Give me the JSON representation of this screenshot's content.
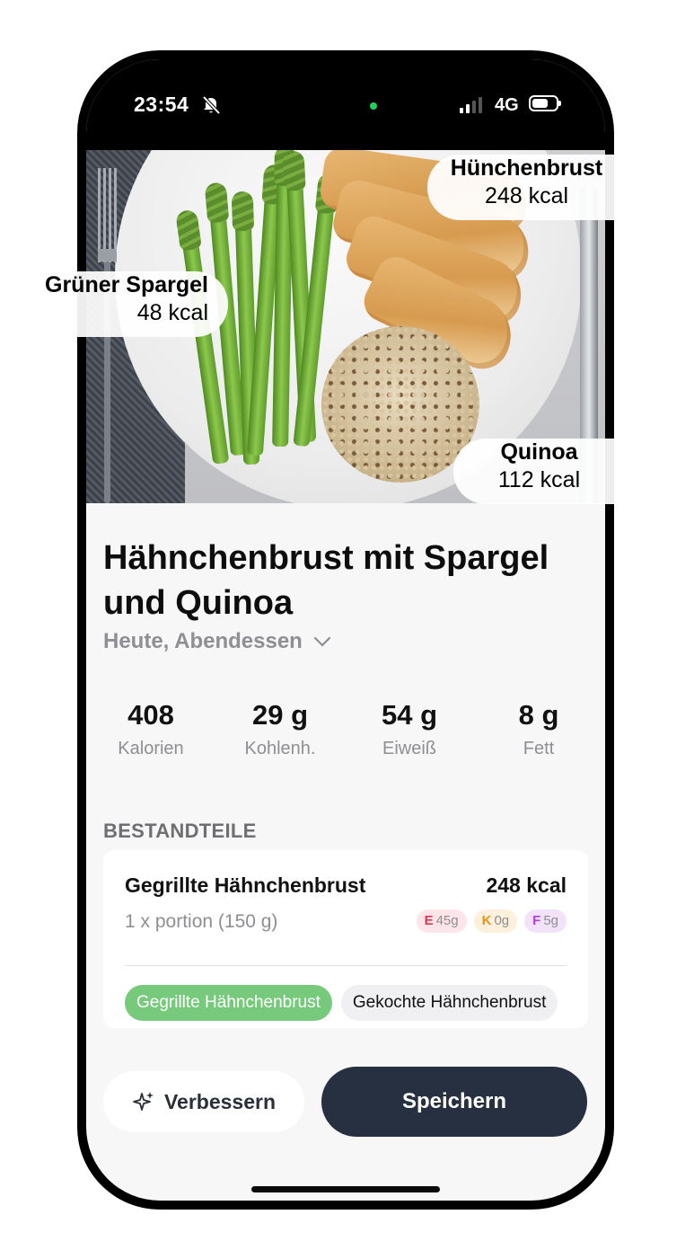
{
  "status": {
    "time": "23:54",
    "network": "4G"
  },
  "photo_labels": [
    {
      "name": "Hünchenbrust",
      "kcal": "248 kcal"
    },
    {
      "name": "Grüner Spargel",
      "kcal": "48 kcal"
    },
    {
      "name": "Quinoa",
      "kcal": "112 kcal"
    }
  ],
  "meal": {
    "title": "Hähnchenbrust mit Spargel und Quinoa",
    "subtitle": "Heute, Abendessen"
  },
  "stats": [
    {
      "value": "408",
      "label": "Kalorien"
    },
    {
      "value": "29 g",
      "label": "Kohlenh."
    },
    {
      "value": "54 g",
      "label": "Eiweiß"
    },
    {
      "value": "8 g",
      "label": "Fett"
    }
  ],
  "section_title": "BESTANDTEILE",
  "ingredient": {
    "name": "Gegrillte Hähnchenbrust",
    "kcal": "248 kcal",
    "portion": "1 x portion (150 g)",
    "macros": [
      {
        "key": "E",
        "value": "45g",
        "color": "#e23552"
      },
      {
        "key": "K",
        "value": "0g",
        "color": "#e8931c"
      },
      {
        "key": "F",
        "value": "5g",
        "color": "#b13ee0"
      }
    ],
    "alternatives": [
      "Gegrillte Hähnchenbrust",
      "Gekochte Hähnchenbrust"
    ]
  },
  "actions": {
    "improve": "Verbessern",
    "save": "Speichern"
  },
  "colors": {
    "save_button": "#263040",
    "selected_chip": "#77c97c"
  }
}
